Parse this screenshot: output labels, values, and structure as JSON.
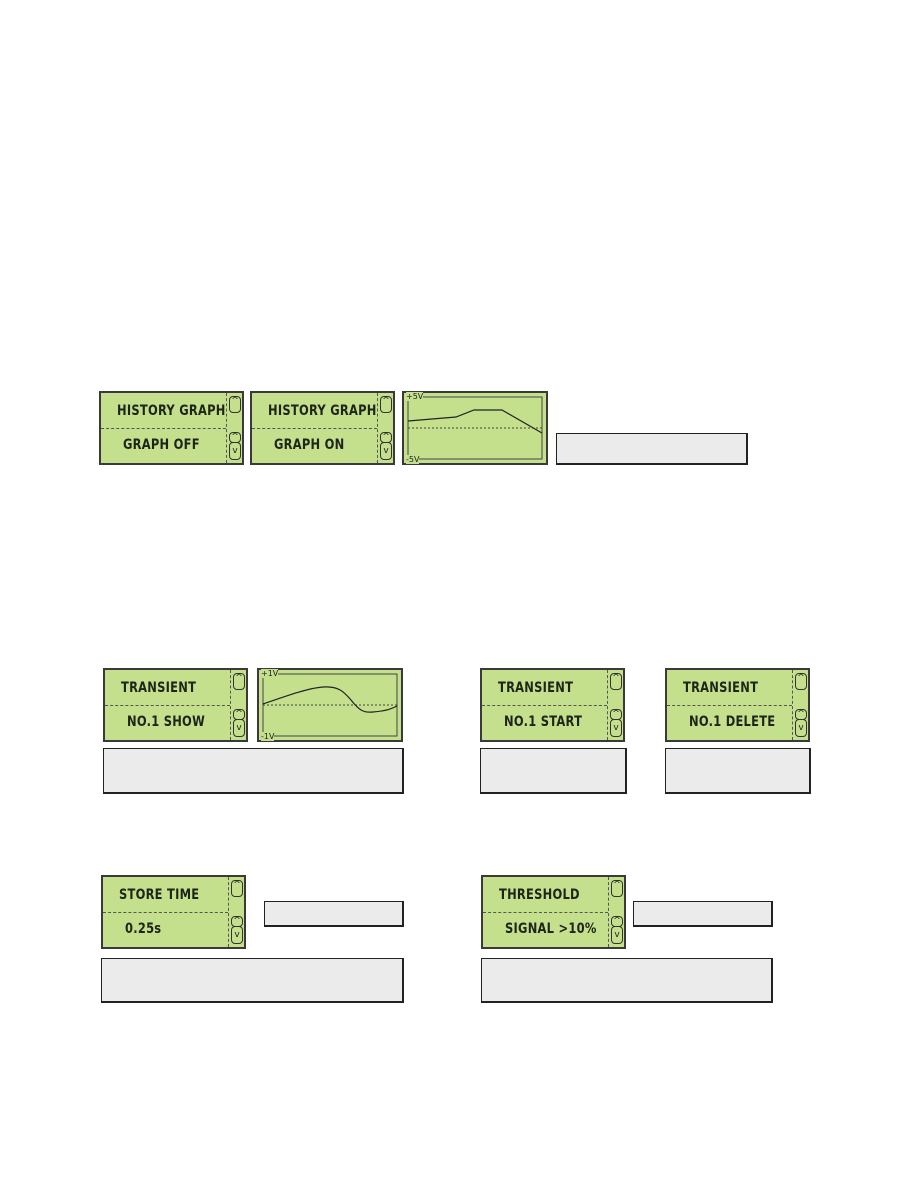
{
  "colors": {
    "lcd": "#c4e08c",
    "border": "#3a3a3a",
    "box": "#ebebeb"
  },
  "history": {
    "off": {
      "line1": "HISTORY GRAPH",
      "line2": "GRAPH OFF"
    },
    "on": {
      "line1": "HISTORY GRAPH",
      "line2": "GRAPH ON"
    },
    "graph": {
      "top_label": "+5V",
      "bottom_label": "-5V"
    }
  },
  "transient": {
    "show": {
      "line1": "TRANSIENT",
      "line2": "NO.1 SHOW"
    },
    "graph": {
      "top_label": "+1V",
      "bottom_label": "-1V"
    },
    "start": {
      "line1": "TRANSIENT",
      "line2": "NO.1 START"
    },
    "delete": {
      "line1": "TRANSIENT",
      "line2": "NO.1 DELETE"
    }
  },
  "store": {
    "line1": "STORE TIME",
    "line2": "0.25s"
  },
  "threshold": {
    "line1": "THRESHOLD",
    "line2": "SIGNAL >10%"
  },
  "icons": {
    "scroll_up": "chevron-up-icon",
    "scroll_down": "chevron-down-icon"
  }
}
